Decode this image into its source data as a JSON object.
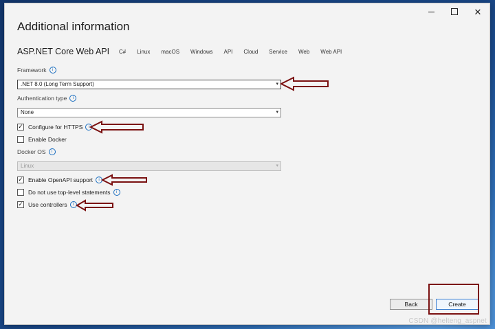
{
  "window": {
    "title": "Additional information",
    "project_name": "ASP.NET Core Web API",
    "tags": [
      "C#",
      "Linux",
      "macOS",
      "Windows",
      "API",
      "Cloud",
      "Service",
      "Web",
      "Web API"
    ]
  },
  "form": {
    "framework": {
      "label": "Framework",
      "value": ".NET 8.0 (Long Term Support)"
    },
    "auth": {
      "label": "Authentication type",
      "value": "None"
    },
    "https": {
      "label": "Configure for HTTPS",
      "checked": true
    },
    "docker": {
      "label": "Enable Docker",
      "checked": false
    },
    "docker_os": {
      "label": "Docker OS",
      "value": "Linux",
      "disabled": true
    },
    "openapi": {
      "label": "Enable OpenAPI support",
      "checked": true
    },
    "top_level": {
      "label": "Do not use top-level statements",
      "checked": false
    },
    "controllers": {
      "label": "Use controllers",
      "checked": true
    }
  },
  "buttons": {
    "back": "Back",
    "create": "Create"
  },
  "icons": {
    "info": "i",
    "check": "✓",
    "caret": "▾",
    "close": "✕"
  },
  "watermark": "CSDN @helteng_aspnet",
  "colors": {
    "annotation": "#7a1010",
    "accent": "#3c7fd0"
  }
}
